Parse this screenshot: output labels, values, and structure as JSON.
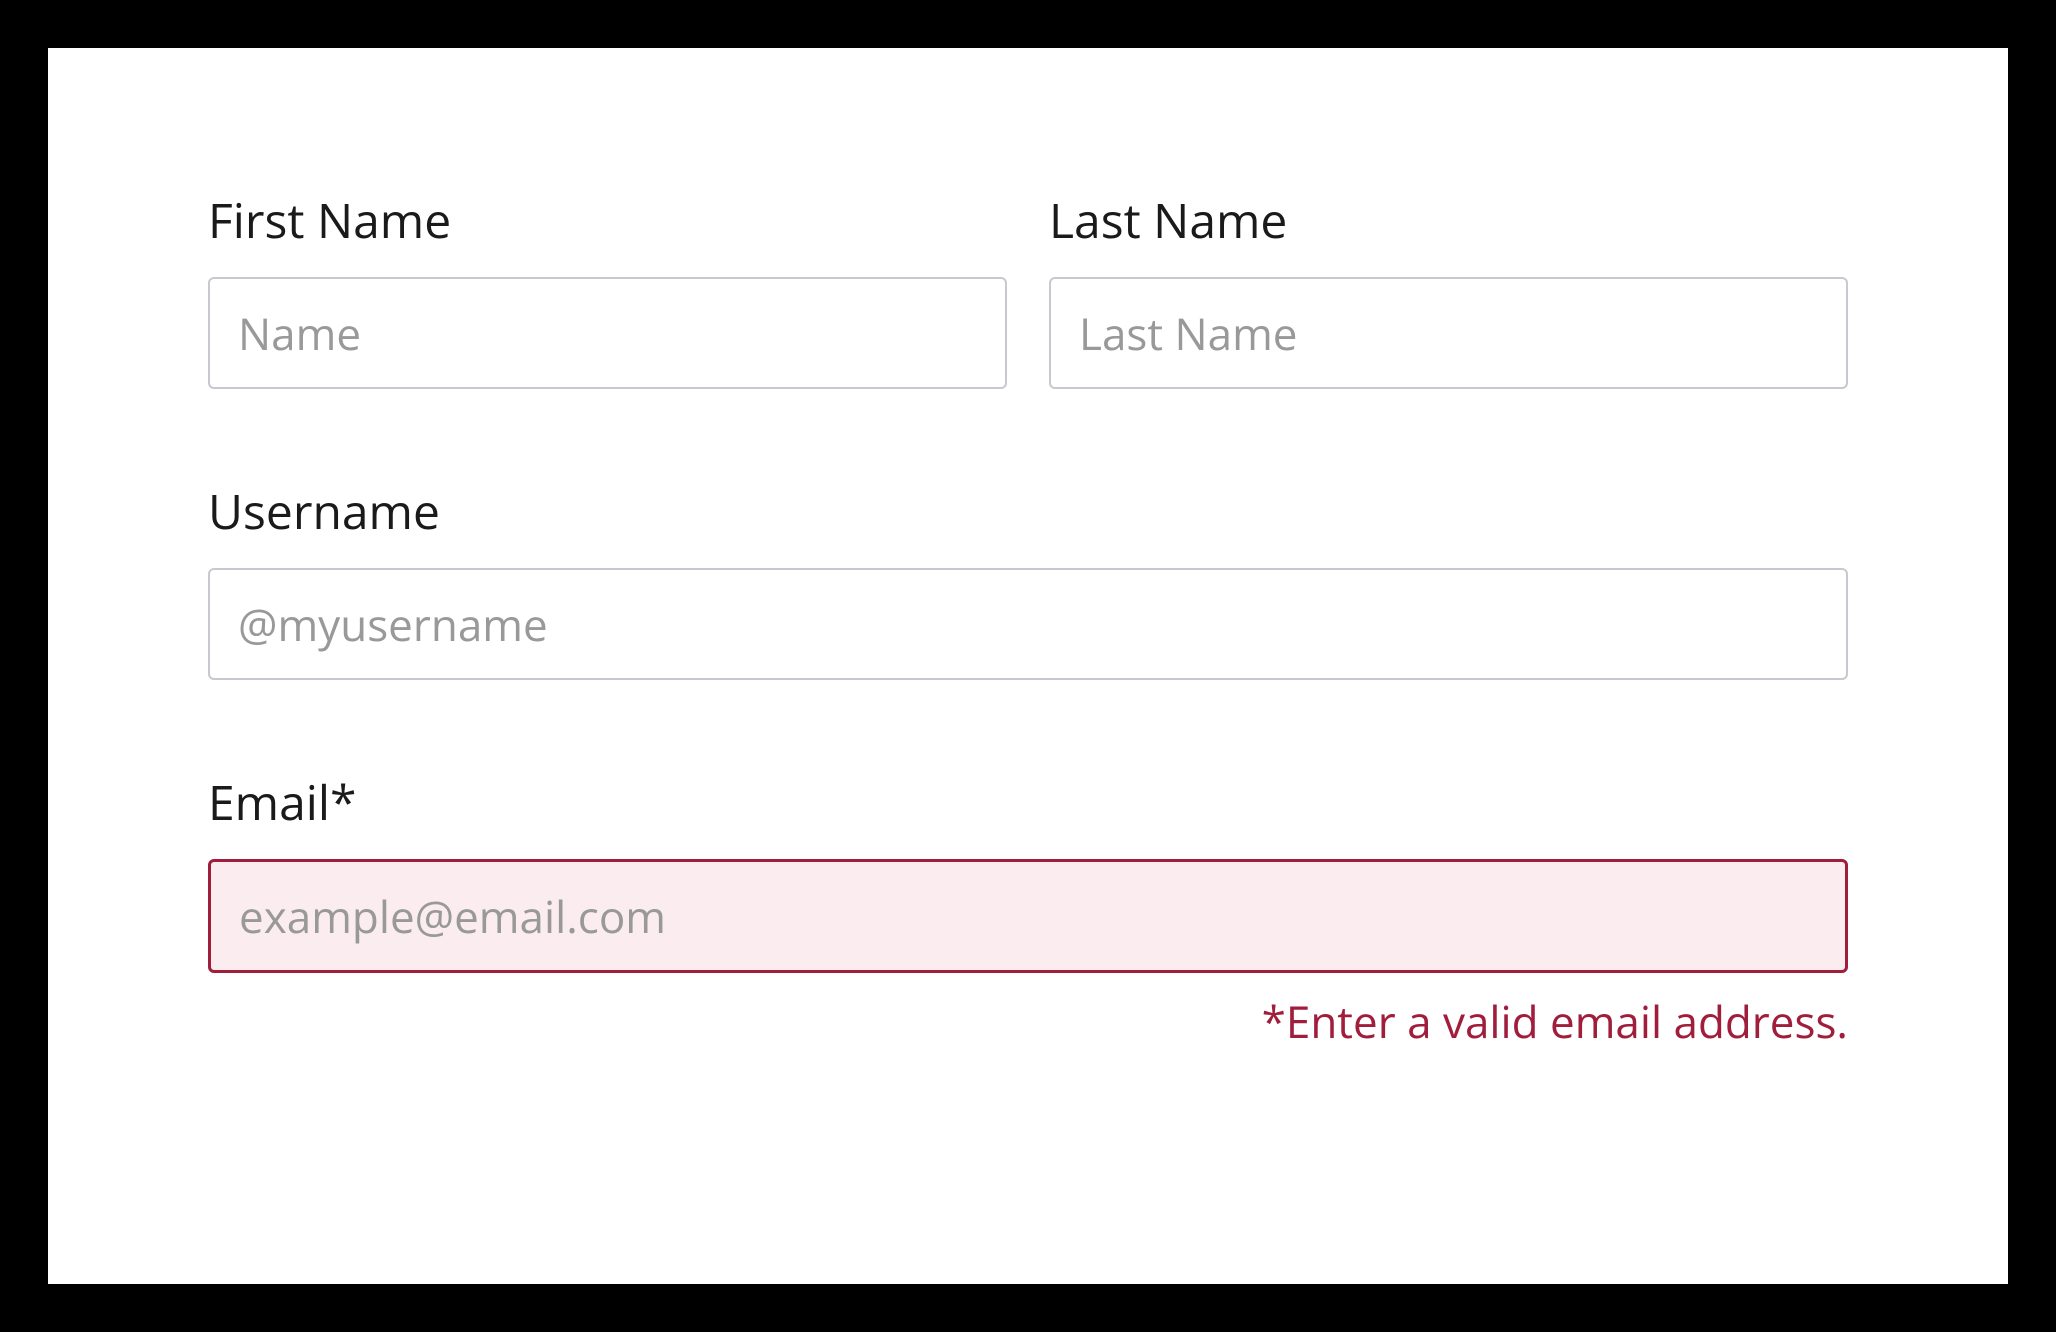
{
  "form": {
    "firstName": {
      "label": "First Name",
      "placeholder": "Name",
      "value": ""
    },
    "lastName": {
      "label": "Last Name",
      "placeholder": "Last Name",
      "value": ""
    },
    "username": {
      "label": "Username",
      "placeholder": "@myusername",
      "value": ""
    },
    "email": {
      "label": "Email*",
      "placeholder": "example@email.com",
      "value": "",
      "errorMessage": "*Enter a valid email address."
    }
  }
}
